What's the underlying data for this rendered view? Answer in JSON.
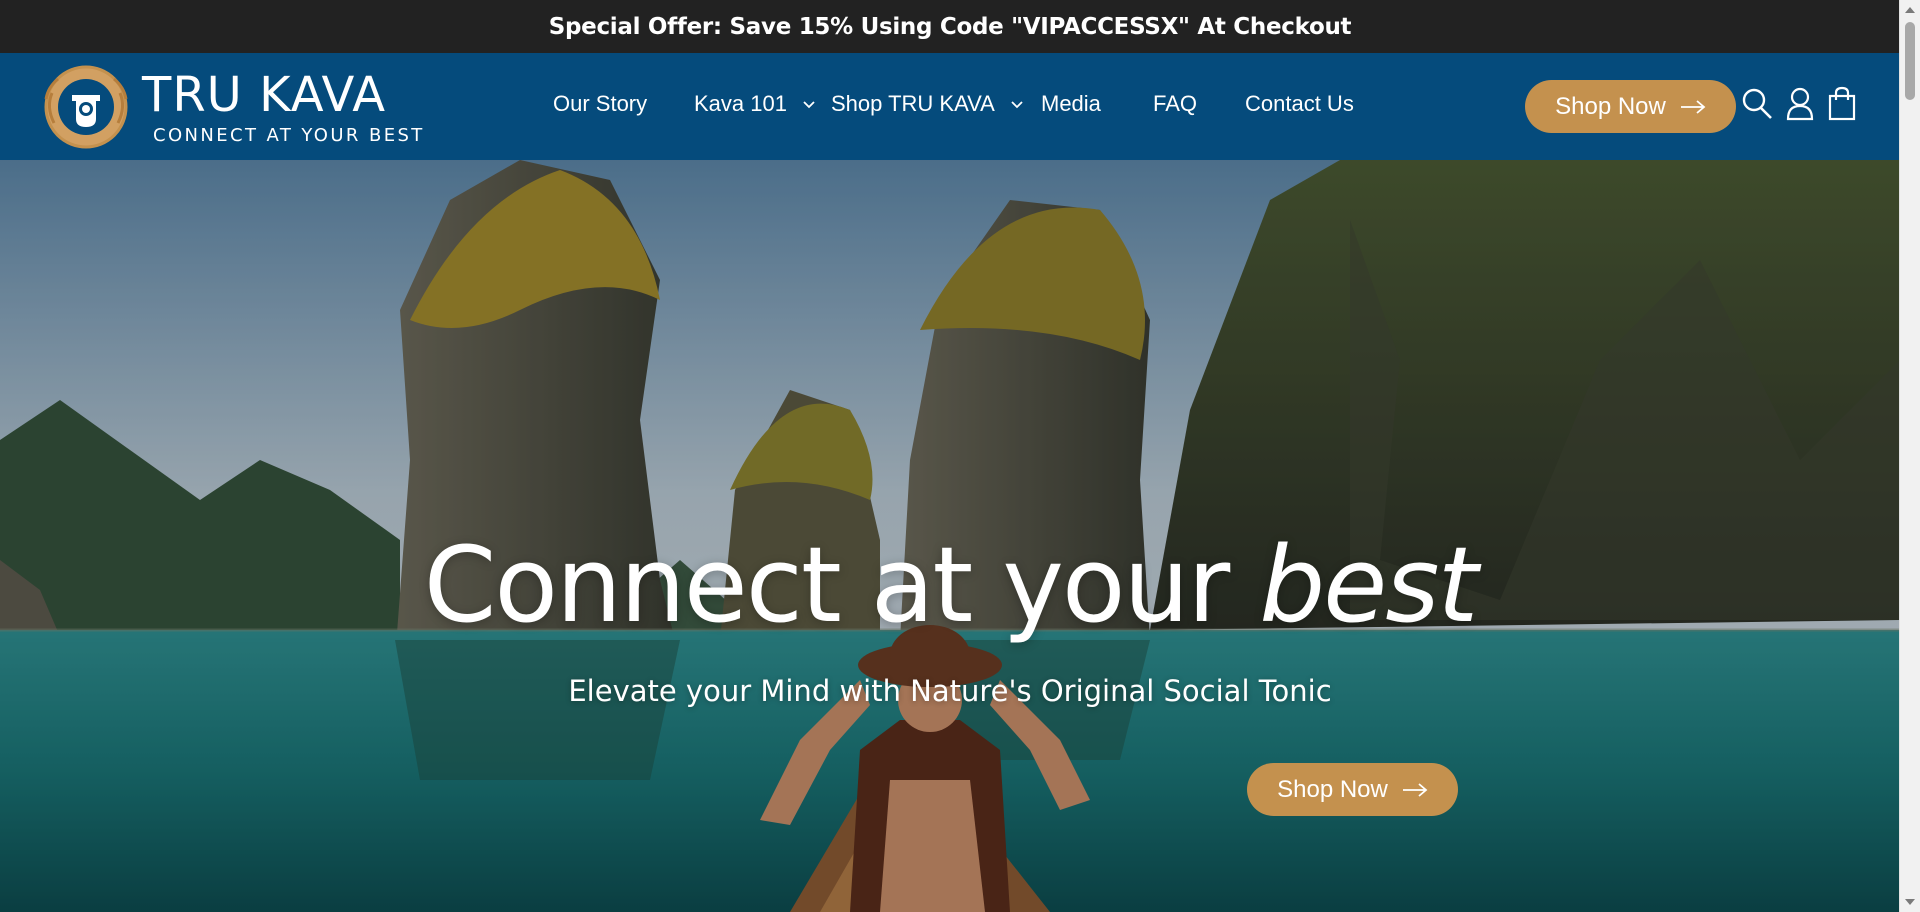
{
  "announcement": {
    "text": "Special Offer: Save 15% Using Code \"VIPACCESSX\" At Checkout"
  },
  "brand": {
    "name": "TRU KAVA",
    "tagline": "CONNECT AT YOUR BEST"
  },
  "nav": {
    "items": [
      {
        "label": "Our Story",
        "has_dropdown": false
      },
      {
        "label": "Kava 101",
        "has_dropdown": true
      },
      {
        "label": "Shop TRU KAVA",
        "has_dropdown": true
      },
      {
        "label": "Media",
        "has_dropdown": false
      },
      {
        "label": "FAQ",
        "has_dropdown": false
      },
      {
        "label": "Contact Us",
        "has_dropdown": false
      }
    ]
  },
  "header": {
    "cta_label": "Shop Now",
    "cta_icon": "arrow-right-icon",
    "icons": [
      "search-icon",
      "account-icon",
      "cart-icon"
    ]
  },
  "hero": {
    "title_main": "Connect at your ",
    "title_emphasis": "best",
    "subtitle": "Elevate your Mind with Nature's Original Social Tonic",
    "cta_label": "Shop Now",
    "cta_icon": "arrow-right-icon"
  },
  "colors": {
    "announcement_bg": "#222222",
    "header_bg": "#054b7c",
    "accent": "#c4914e",
    "text_light": "#ffffff"
  }
}
